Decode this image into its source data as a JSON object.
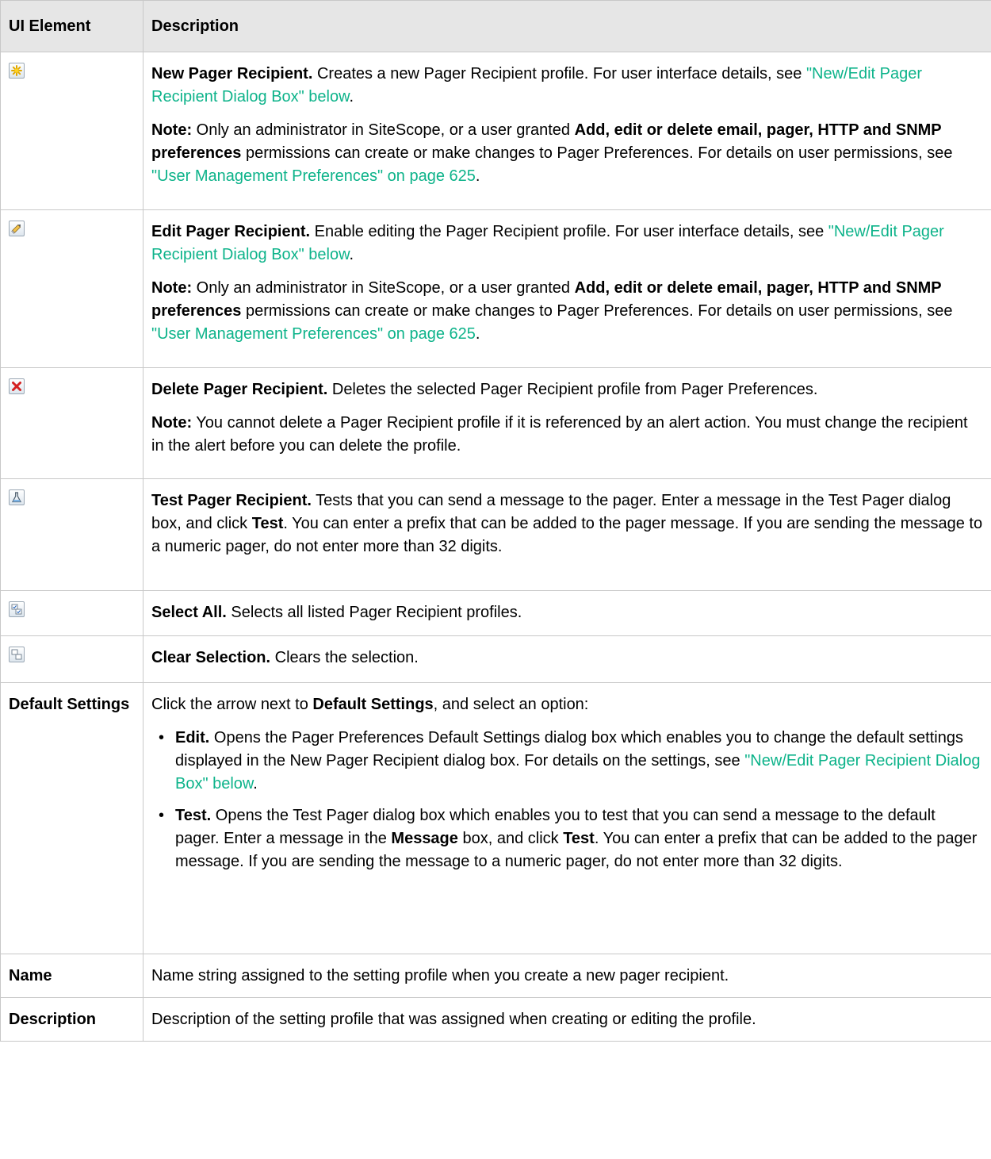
{
  "header": {
    "col1": "UI Element",
    "col2": "Description"
  },
  "rows": {
    "new": {
      "icon": "new-icon",
      "title": "New Pager Recipient.",
      "text": " Creates a new Pager Recipient profile. For user interface details, see ",
      "link": "\"New/Edit Pager Recipient Dialog Box\" below",
      "end": ".",
      "note": {
        "label": "Note:",
        "t1": " Only an administrator in SiteScope, or a user granted ",
        "bold": "Add, edit or delete email, pager, HTTP and SNMP preferences",
        "t2": " permissions can create or make changes to Pager Preferences. For details on user permissions, see ",
        "link": "\"User Management Preferences\" on page 625",
        "end": "."
      }
    },
    "edit": {
      "icon": "pencil-icon",
      "title": "Edit Pager Recipient.",
      "text": " Enable editing the Pager Recipient profile. For user interface details, see ",
      "link": "\"New/Edit Pager Recipient Dialog Box\" below",
      "end": ".",
      "note": {
        "label": "Note:",
        "t1": " Only an administrator in SiteScope, or a user granted ",
        "bold": "Add, edit or delete email, pager, HTTP and SNMP preferences",
        "t2": " permissions can create or make changes to Pager Preferences. For details on user permissions, see ",
        "link": "\"User Management Preferences\" on page 625",
        "end": "."
      }
    },
    "delete": {
      "icon": "delete-icon",
      "title": "Delete Pager Recipient.",
      "text": " Deletes the selected Pager Recipient profile from Pager Preferences.",
      "note": {
        "label": "Note:",
        "t1": " You cannot delete a Pager Recipient profile if it is referenced by an alert action. You must change the recipient in the alert before you can delete the profile."
      }
    },
    "test": {
      "icon": "flask-icon",
      "title": "Test Pager Recipient.",
      "t1": " Tests that you can send a message to the pager. Enter a message in the Test Pager dialog box, and click ",
      "bold": "Test",
      "t2": ". You can enter a prefix that can be added to the pager message. If you are sending the message to a numeric pager, do not enter more than 32 digits."
    },
    "select_all": {
      "icon": "select-all-icon",
      "title": "Select All.",
      "text": " Selects all listed Pager Recipient profiles."
    },
    "clear": {
      "icon": "clear-selection-icon",
      "title": "Clear Selection.",
      "text": " Clears the selection."
    },
    "defaults": {
      "element": "Default Settings",
      "intro1": "Click the arrow next to ",
      "intro_bold": "Default Settings",
      "intro2": ", and select an option:",
      "edit": {
        "label": "Edit.",
        "text": " Opens the Pager Preferences Default Settings dialog box which enables you to change the default settings displayed in the New Pager Recipient dialog box. For details on the settings, see ",
        "link": "\"New/Edit Pager Recipient Dialog Box\" below",
        "end": "."
      },
      "test": {
        "label": "Test.",
        "t1": " Opens the Test Pager dialog box which enables you to test that you can send a message to the default pager. Enter a message in the ",
        "bold1": "Message",
        "t2": " box, and click ",
        "bold2": "Test",
        "t3": ". You can enter a prefix that can be added to the pager message. If you are sending the message to a numeric pager, do not enter more than 32 digits."
      }
    },
    "name": {
      "element": "Name",
      "text": "Name string assigned to the setting profile when you create a new pager recipient."
    },
    "description": {
      "element": "Description",
      "text": "Description of the setting profile that was assigned when creating or editing the profile."
    }
  }
}
